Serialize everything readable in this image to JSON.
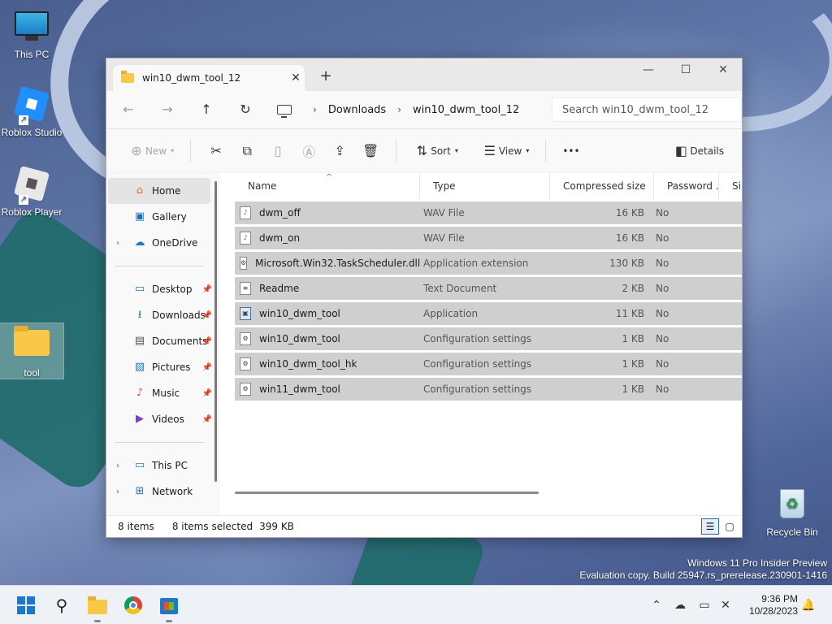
{
  "desktop": {
    "icons": [
      {
        "label": "This PC"
      },
      {
        "label": "Roblox Studio"
      },
      {
        "label": "Roblox Player"
      },
      {
        "label": "tool"
      },
      {
        "label": "Recycle Bin"
      }
    ],
    "watermark_line1": "Windows 11 Pro Insider Preview",
    "watermark_line2": "Evaluation copy. Build 25947.rs_prerelease.230901-1416"
  },
  "window": {
    "tab_title": "win10_dwm_tool_12",
    "new_tab_label": "+",
    "controls": {
      "minimize": "—",
      "maximize": "☐",
      "close": "✕"
    },
    "address": {
      "crumbs": [
        "Downloads",
        "win10_dwm_tool_12"
      ],
      "search_placeholder": "Search win10_dwm_tool_12"
    },
    "toolbar": {
      "new_label": "New",
      "sort_label": "Sort",
      "view_label": "View",
      "details_label": "Details",
      "more_label": "•••"
    },
    "nav": {
      "home": "Home",
      "gallery": "Gallery",
      "onedrive": "OneDrive",
      "quick_access": [
        {
          "label": "Desktop",
          "icon": "desktop-icon"
        },
        {
          "label": "Downloads",
          "icon": "downloads-icon"
        },
        {
          "label": "Documents",
          "icon": "documents-icon"
        },
        {
          "label": "Pictures",
          "icon": "pictures-icon"
        },
        {
          "label": "Music",
          "icon": "music-icon"
        },
        {
          "label": "Videos",
          "icon": "videos-icon"
        }
      ],
      "this_pc": "This PC",
      "network": "Network"
    },
    "columns": {
      "name": "Name",
      "type": "Type",
      "compressed_size": "Compressed size",
      "password": "Password ...",
      "extra": "Si"
    },
    "files": [
      {
        "name": "dwm_off",
        "type": "WAV File",
        "size": "16 KB",
        "password": "No",
        "icon": "wav"
      },
      {
        "name": "dwm_on",
        "type": "WAV File",
        "size": "16 KB",
        "password": "No",
        "icon": "wav"
      },
      {
        "name": "Microsoft.Win32.TaskScheduler.dll",
        "type": "Application extension",
        "size": "130 KB",
        "password": "No",
        "icon": "dll"
      },
      {
        "name": "Readme",
        "type": "Text Document",
        "size": "2 KB",
        "password": "No",
        "icon": "txt"
      },
      {
        "name": "win10_dwm_tool",
        "type": "Application",
        "size": "11 KB",
        "password": "No",
        "icon": "exe"
      },
      {
        "name": "win10_dwm_tool",
        "type": "Configuration settings",
        "size": "1 KB",
        "password": "No",
        "icon": "ini"
      },
      {
        "name": "win10_dwm_tool_hk",
        "type": "Configuration settings",
        "size": "1 KB",
        "password": "No",
        "icon": "ini"
      },
      {
        "name": "win11_dwm_tool",
        "type": "Configuration settings",
        "size": "1 KB",
        "password": "No",
        "icon": "ini"
      }
    ],
    "status": {
      "item_count": "8 items",
      "selected": "8 items selected",
      "selected_size": "399 KB"
    }
  },
  "taskbar": {
    "time": "9:36 PM",
    "date": "10/28/2023"
  }
}
